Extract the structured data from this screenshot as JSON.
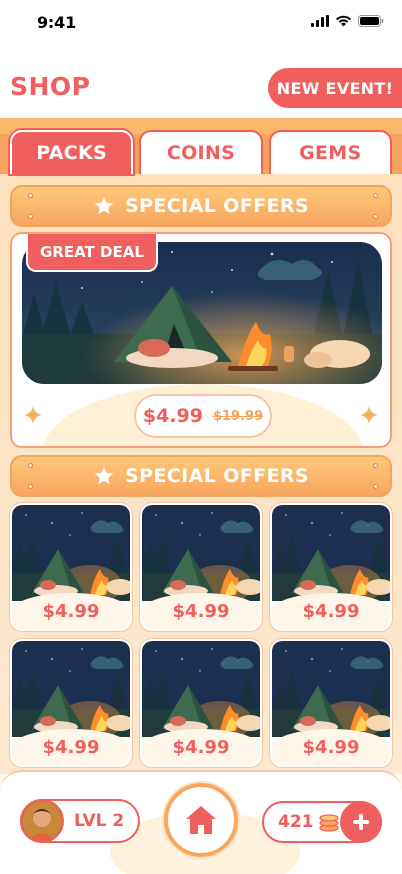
{
  "status_bar": {
    "time": "9:41"
  },
  "header": {
    "title": "SHOP",
    "event_button": "NEW EVENT!"
  },
  "tabs": [
    {
      "label": "PACKS",
      "active": true
    },
    {
      "label": "COINS",
      "active": false
    },
    {
      "label": "GEMS",
      "active": false
    }
  ],
  "banners": {
    "top": "SPECIAL OFFERS",
    "second": "SPECIAL OFFERS"
  },
  "featured": {
    "badge": "GREAT DEAL",
    "price": "$4.99",
    "old_price": "$19.99",
    "image": "campsite-illustration"
  },
  "packs": [
    {
      "price": "$4.99"
    },
    {
      "price": "$4.99"
    },
    {
      "price": "$4.99"
    },
    {
      "price": "$4.99"
    },
    {
      "price": "$4.99"
    },
    {
      "price": "$4.99"
    }
  ],
  "bottom_bar": {
    "level": "LVL 2",
    "coins": "421",
    "home_icon": "home-icon",
    "plus_icon": "plus-icon"
  },
  "colors": {
    "accent": "#ef5f5d",
    "orange": "#f6a85f",
    "cream": "#fff1d6"
  }
}
